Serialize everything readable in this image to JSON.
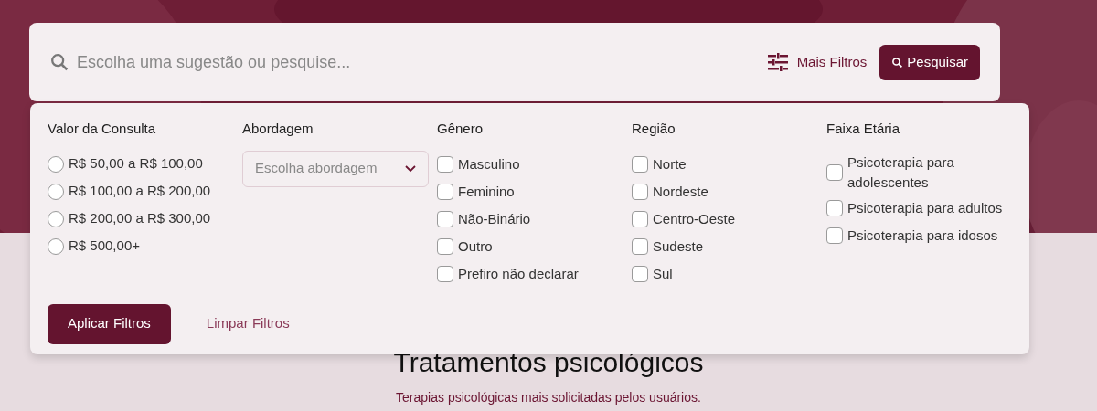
{
  "search": {
    "placeholder": "Escolha uma sugestão ou pesquise...",
    "more_filters": "Mais Filtros",
    "button": "Pesquisar"
  },
  "filters": {
    "price": {
      "title": "Valor da Consulta",
      "options": [
        {
          "label": "R$ 50,00 a R$ 100,00",
          "selected": false
        },
        {
          "label": "R$ 100,00 a R$ 200,00",
          "selected": false
        },
        {
          "label": "R$ 200,00 a R$ 300,00",
          "selected": false
        },
        {
          "label": "R$ 500,00+",
          "selected": false
        }
      ]
    },
    "approach": {
      "title": "Abordagem",
      "placeholder": "Escolha abordagem"
    },
    "gender": {
      "title": "Gênero",
      "options": [
        {
          "label": "Masculino",
          "checked": false
        },
        {
          "label": "Feminino",
          "checked": false
        },
        {
          "label": "Não-Binário",
          "checked": false
        },
        {
          "label": "Outro",
          "checked": false
        },
        {
          "label": "Prefiro não declarar",
          "checked": false
        }
      ]
    },
    "region": {
      "title": "Região",
      "options": [
        {
          "label": "Norte",
          "checked": false
        },
        {
          "label": "Nordeste",
          "checked": false
        },
        {
          "label": "Centro-Oeste",
          "checked": false
        },
        {
          "label": "Sudeste",
          "checked": false
        },
        {
          "label": "Sul",
          "checked": false
        }
      ]
    },
    "age": {
      "title": "Faixa Etária",
      "options": [
        {
          "label": "Psicoterapia para adolescentes",
          "checked": false
        },
        {
          "label": "Psicoterapia para adultos",
          "checked": false
        },
        {
          "label": "Psicoterapia para idosos",
          "checked": false
        }
      ]
    },
    "apply": "Aplicar Filtros",
    "clear": "Limpar Filtros"
  },
  "section": {
    "title": "Tratamentos psicológicos",
    "subtitle": "Terapias psicológicas mais solicitadas pelos usuários."
  }
}
